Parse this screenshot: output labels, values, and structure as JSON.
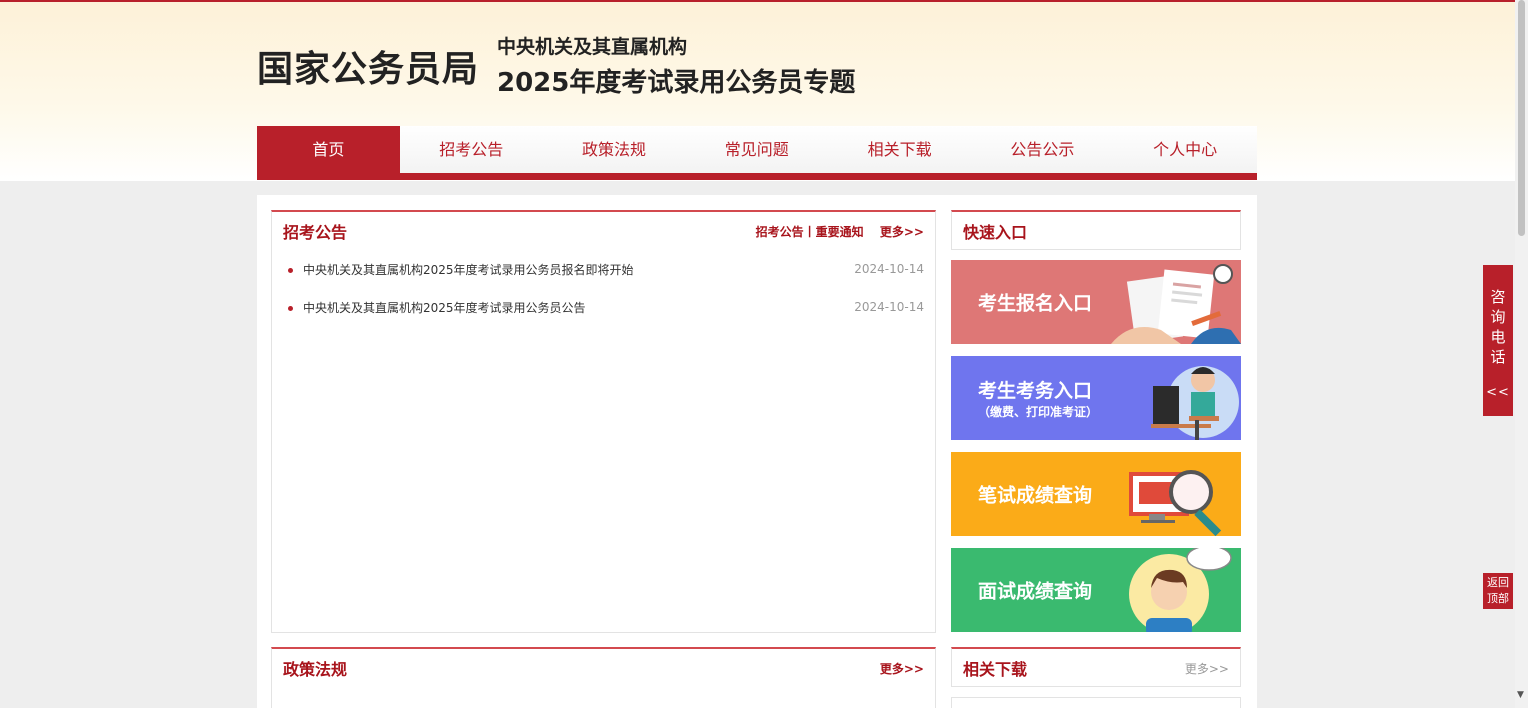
{
  "header": {
    "brand": "国家公务员局",
    "subtitle_top": "中央机关及其直属机构",
    "subtitle_main": "2025年度考试录用公务员专题"
  },
  "nav": {
    "items": [
      "首页",
      "招考公告",
      "政策法规",
      "常见问题",
      "相关下载",
      "公告公示",
      "个人中心"
    ],
    "active": "首页"
  },
  "notices": {
    "title": "招考公告",
    "links": "招考公告丨重要通知",
    "more": "更多>>",
    "items": [
      {
        "text": "中央机关及其直属机构2025年度考试录用公务员报名即将开始",
        "date": "2024-10-14"
      },
      {
        "text": "中央机关及其直属机构2025年度考试录用公务员公告",
        "date": "2024-10-14"
      }
    ]
  },
  "quick": {
    "title": "快速入口",
    "tiles": [
      {
        "label": "考生报名入口",
        "sub": "",
        "color": "#de7776"
      },
      {
        "label": "考生考务入口",
        "sub": "（缴费、打印准考证）",
        "color": "#6f75ee"
      },
      {
        "label": "笔试成绩查询",
        "sub": "",
        "color": "#fbab18"
      },
      {
        "label": "面试成绩查询",
        "sub": "",
        "color": "#3aba6f"
      }
    ]
  },
  "policy": {
    "title": "政策法规",
    "more": "更多>>"
  },
  "downloads": {
    "title": "相关下载",
    "more": "更多>>"
  },
  "side": {
    "consult": [
      "咨",
      "询",
      "电",
      "话"
    ],
    "arrows": "<<",
    "back_top": [
      "返回",
      "顶部"
    ]
  },
  "colors": {
    "brand_red": "#b8202a",
    "title_red": "#a8141c"
  }
}
